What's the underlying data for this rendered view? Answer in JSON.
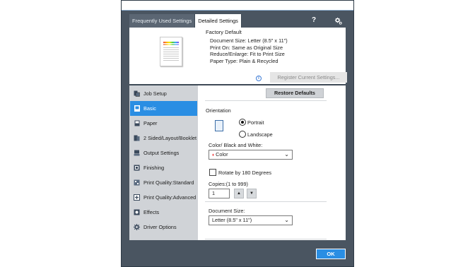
{
  "tabs": [
    {
      "label": "Frequently Used Settings",
      "active": false
    },
    {
      "label": "Detailed Settings",
      "active": true
    }
  ],
  "header": {
    "help_icon": "question-icon",
    "settings_icon": "gear-icon",
    "help_label": "?"
  },
  "summary": {
    "title": "Factory Default",
    "lines": [
      "Document Size:  Letter (8.5\" x 11\")",
      "Print On:  Same as Original Size",
      "Reduce/Enlarge:  Fit to Print Size",
      "Paper Type:  Plain & Recycled"
    ],
    "register_label": "Register Current Settings..."
  },
  "sidebar": {
    "items": [
      {
        "label": "Job Setup",
        "icon": "job-setup-icon",
        "active": false
      },
      {
        "label": "Basic",
        "icon": "basic-icon",
        "active": true
      },
      {
        "label": "Paper",
        "icon": "paper-icon",
        "active": false
      },
      {
        "label": "2 Sided/Layout/Booklet",
        "icon": "layout-icon",
        "active": false
      },
      {
        "label": "Output Settings",
        "icon": "output-icon",
        "active": false
      },
      {
        "label": "Finishing",
        "icon": "finishing-icon",
        "active": false
      },
      {
        "label": "Print Quality:Standard",
        "icon": "quality-standard-icon",
        "active": false
      },
      {
        "label": "Print Quality:Advanced",
        "icon": "quality-advanced-icon",
        "active": false
      },
      {
        "label": "Effects",
        "icon": "effects-icon",
        "active": false
      },
      {
        "label": "Driver Options",
        "icon": "driver-options-icon",
        "active": false
      }
    ]
  },
  "basic": {
    "restore_label": "Restore Defaults",
    "orientation_label": "Orientation",
    "portrait_label": "Portrait",
    "landscape_label": "Landscape",
    "orientation_value": "Portrait",
    "color_label": "Color/ Black and White:",
    "color_value": "Color",
    "rotate_label": "Rotate by 180 Degrees",
    "rotate_checked": false,
    "copies_label": "Copies:(1 to 999)",
    "copies_value": "1",
    "doc_size_label": "Document Size:",
    "doc_size_value": "Letter (8.5\" x 11\")"
  },
  "footer": {
    "ok_label": "OK"
  },
  "colors": {
    "accent": "#2a8ee3",
    "frame": "#4a5561",
    "sidebar_bg": "#d0d3d7"
  }
}
